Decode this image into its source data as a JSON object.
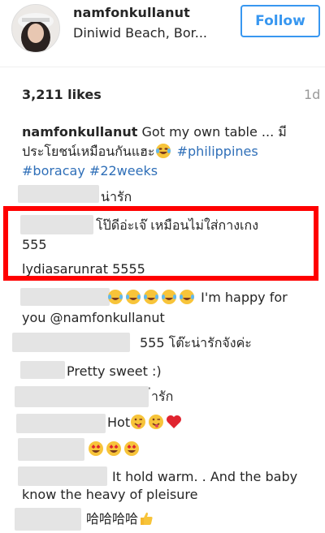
{
  "header": {
    "username": "namfonkullanut",
    "location": "Diniwid Beach, Bor...",
    "follow_label": "Follow"
  },
  "post": {
    "likes": "3,211 likes",
    "time": "1d",
    "caption": {
      "author": "namfonkullanut",
      "text_line1": "Got my own table ... มี",
      "text_line2": "ประโยชน์เหมือนกันแฮะ",
      "tag1": "#philippines",
      "tag2": "#boracay",
      "tag3": "#22weeks"
    }
  },
  "comments": [
    {
      "text": "น่ารัก"
    },
    {
      "text_line1": "โป๊ดีอ่ะเจ๊ เหมือนไม่ใส่กางเกง",
      "text_line2": "555"
    },
    {
      "author": "lydiasarunrat",
      "text": "5555"
    },
    {
      "text_line1": "I'm happy for",
      "text_line2": "you @namfonkullanut"
    },
    {
      "text": "555 โต๊ะน่ารักจังค่ะ"
    },
    {
      "text": "Pretty sweet :)"
    },
    {
      "text": "่ารัก"
    },
    {
      "text": "Hot"
    },
    {
      "text": ""
    },
    {
      "text_line1": "It hold warm. . And the baby",
      "text_line2": "know the heavy of pleisure"
    },
    {
      "text": "哈哈哈哈"
    }
  ],
  "colors": {
    "accent": "#3897f0",
    "hashtag": "#2f6fb8",
    "highlight": "#ff0000"
  }
}
